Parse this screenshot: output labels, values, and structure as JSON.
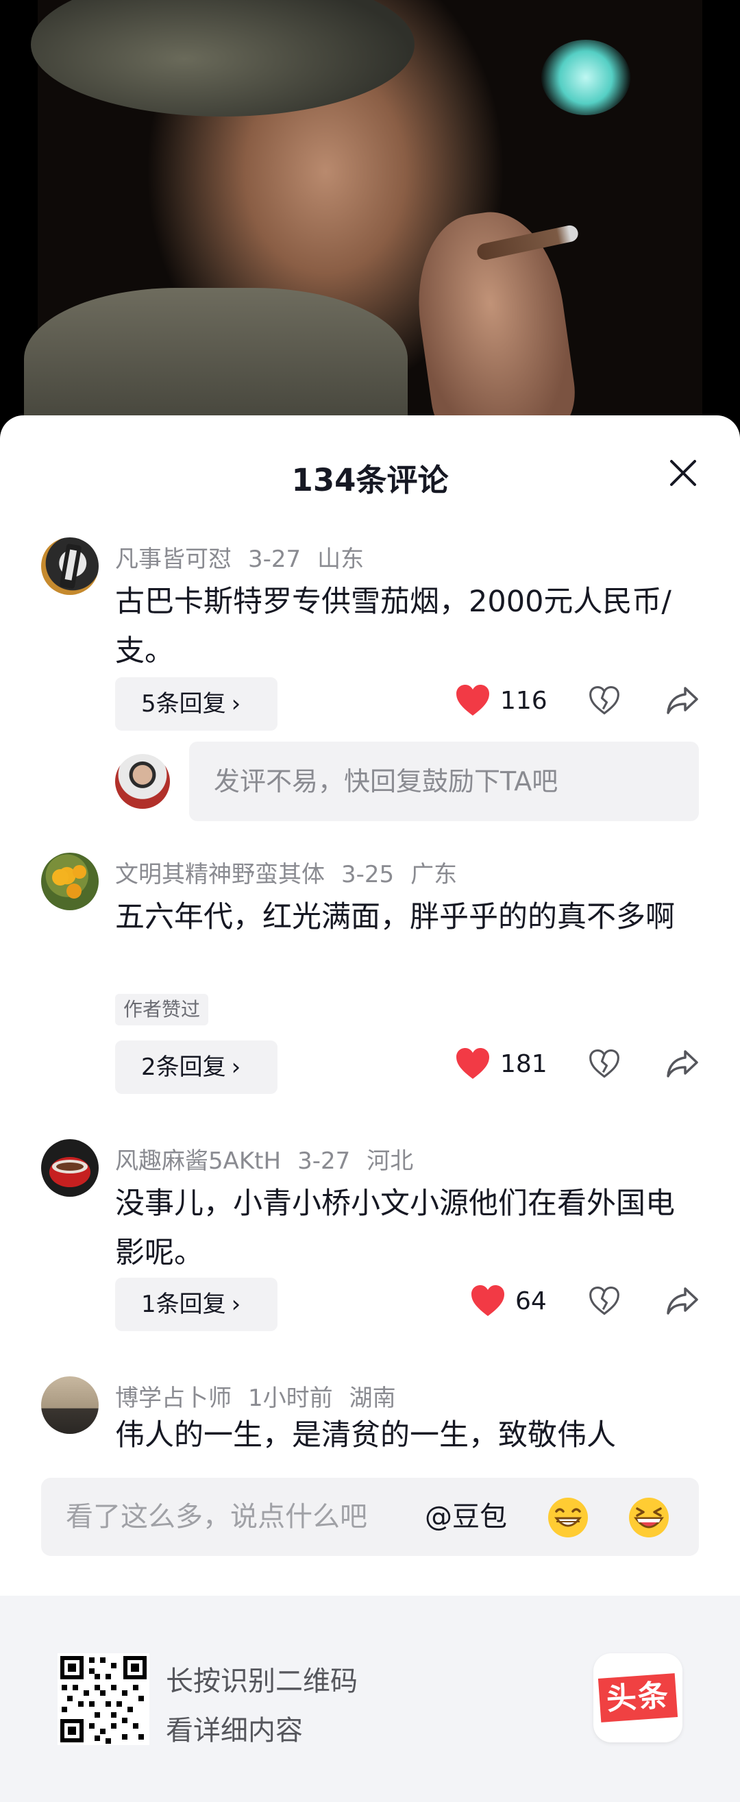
{
  "sheet": {
    "title": "134条评论"
  },
  "comments": [
    {
      "user": "凡事皆可怼",
      "date": "3-27",
      "location": "山东",
      "text": "古巴卡斯特罗专供雪茄烟，2000元人民币/支。",
      "replies_label": "5条回复",
      "likes": "116",
      "author_liked": ""
    },
    {
      "user": "文明其精神野蛮其体",
      "date": "3-25",
      "location": "广东",
      "text": "五六年代，红光满面，胖乎乎的的真不多啊",
      "replies_label": "2条回复",
      "likes": "181",
      "author_liked": "作者赞过"
    },
    {
      "user": "风趣麻酱5AKtH",
      "date": "3-27",
      "location": "河北",
      "text": "没事儿，小青小桥小文小源他们在看外国电影呢。",
      "replies_label": "1条回复",
      "likes": "64",
      "author_liked": ""
    },
    {
      "user": "博学占卜师",
      "date": "1小时前",
      "location": "湖南",
      "text": "伟人的一生，是清贫的一生，致敬伟人",
      "replies_label": "",
      "likes": "",
      "author_liked": ""
    }
  ],
  "reply_prompt": {
    "placeholder": "发评不易，快回复鼓励下TA吧"
  },
  "input_bar": {
    "placeholder": "看了这么多，说点什么吧",
    "mention": "@豆包",
    "emojis": [
      "grin-emoji",
      "laugh-emoji"
    ]
  },
  "footer": {
    "line1": "长按识别二维码",
    "line2": "看详细内容",
    "logo_text": "头条"
  },
  "colors": {
    "like_red": "#f23a45",
    "muted": "#8a8b91",
    "pill_bg": "#f2f2f4",
    "footer_bg": "#f3f4f7"
  }
}
